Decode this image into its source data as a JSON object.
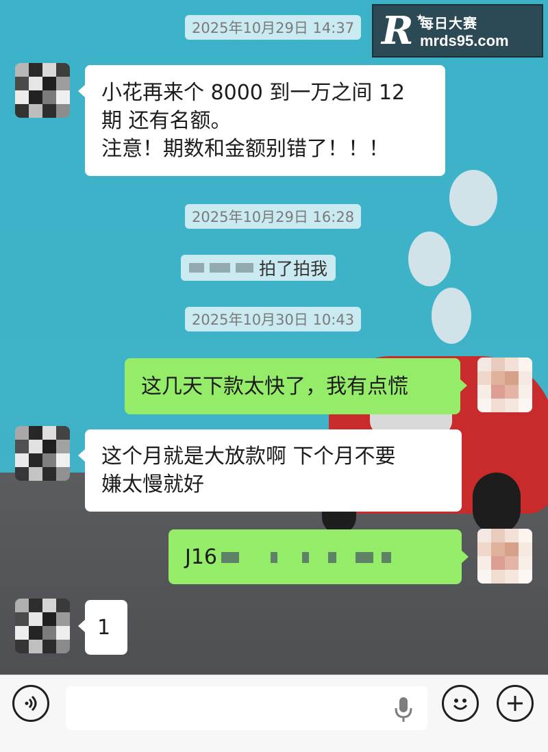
{
  "watermark": {
    "logo_letter": "R",
    "brand_cn": "每日大赛",
    "domain": "mrds95.com"
  },
  "messages": [
    {
      "kind": "timestamp",
      "text": "2025年10月29日 14:37"
    },
    {
      "kind": "incoming",
      "lines": [
        "小花再来个 8000 到一万之间 12",
        "期 还有名额。",
        "注意！期数和金额别错了！！！"
      ]
    },
    {
      "kind": "timestamp",
      "text": "2025年10月29日 16:28"
    },
    {
      "kind": "system",
      "text": "拍了拍我"
    },
    {
      "kind": "timestamp",
      "text": "2025年10月30日 10:43"
    },
    {
      "kind": "outgoing",
      "lines": [
        "这几天下款太快了，我有点慌"
      ]
    },
    {
      "kind": "incoming",
      "lines": [
        "这个月就是大放款啊 下个月不要",
        "嫌太慢就好"
      ]
    },
    {
      "kind": "outgoing",
      "lines": [
        "J16"
      ]
    },
    {
      "kind": "incoming",
      "lines": [
        "1"
      ]
    }
  ],
  "input_bar": {
    "placeholder": "",
    "icons": [
      "voice-icon",
      "mic-icon",
      "emoji-icon",
      "plus-icon"
    ]
  },
  "colors": {
    "bubble_outgoing": "#95ec69",
    "bubble_incoming": "#ffffff",
    "chat_background": "#3fb3c8"
  }
}
